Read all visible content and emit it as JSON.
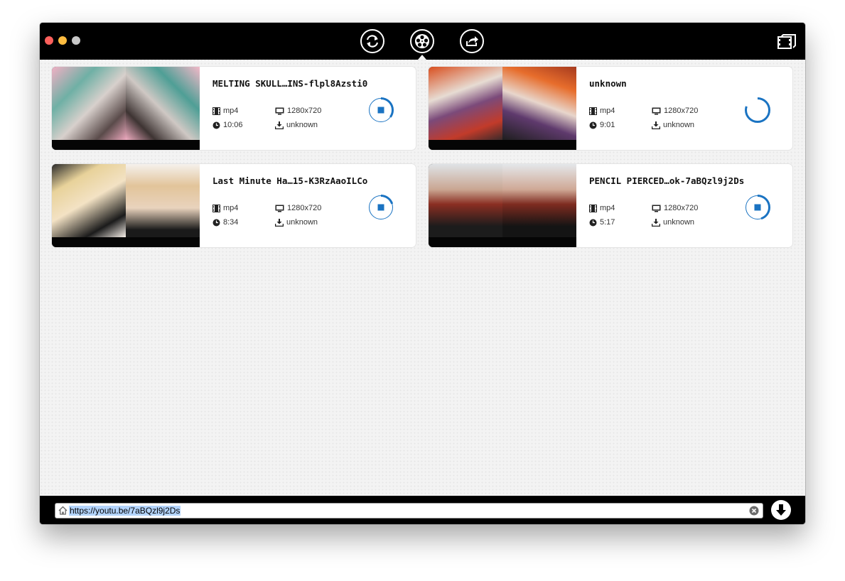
{
  "window": {
    "traffic_colors": {
      "close": "#fc605c",
      "minimize": "#fdbc40",
      "maximize": "#c8c8c8"
    },
    "toolbar": [
      {
        "name": "convert",
        "icon": "refresh-arrows-icon"
      },
      {
        "name": "downloads",
        "icon": "film-reel-icon",
        "active": true
      },
      {
        "name": "share",
        "icon": "share-arrow-icon"
      }
    ],
    "library_icon": "film-library-icon"
  },
  "accent_color": "#1a73c2",
  "videos": [
    {
      "title": "MELTING SKULL…INS-flpl8Azsti0",
      "format": "mp4",
      "resolution": "1280x720",
      "duration": "10:06",
      "size": "unknown",
      "status": "downloading",
      "progress": 0.35
    },
    {
      "title": "unknown",
      "format": "mp4",
      "resolution": "1280x720",
      "duration": "9:01",
      "size": "unknown",
      "status": "loading",
      "progress": 0.8
    },
    {
      "title": "Last Minute Ha…15-K3RzAaoILCo",
      "format": "mp4",
      "resolution": "1280x720",
      "duration": "8:34",
      "size": "unknown",
      "status": "downloading",
      "progress": 0.2
    },
    {
      "title": "PENCIL PIERCED…ok-7aBQzl9j2Ds",
      "format": "mp4",
      "resolution": "1280x720",
      "duration": "5:17",
      "size": "unknown",
      "status": "downloading",
      "progress": 0.45
    }
  ],
  "urlbar": {
    "value": "https://youtu.be/7aBQzl9j2Ds",
    "home_icon": "home-icon",
    "clear_icon": "clear-circle-icon",
    "download_icon": "download-arrow-icon"
  }
}
